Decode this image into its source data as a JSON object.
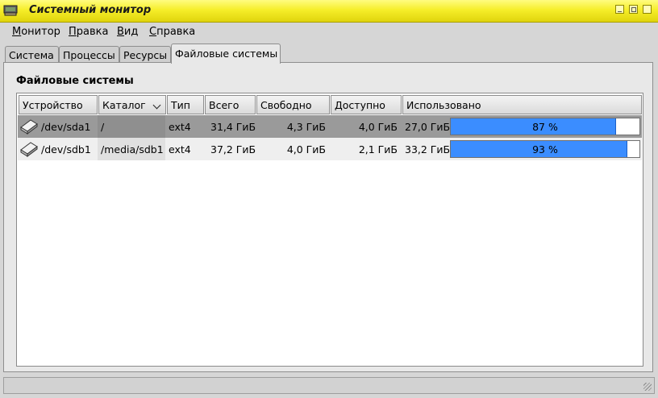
{
  "window": {
    "title": "Системный монитор"
  },
  "menu": [
    "Монитор",
    "Правка",
    "Вид",
    "Справка"
  ],
  "tabs": [
    "Система",
    "Процессы",
    "Ресурсы",
    "Файловые системы"
  ],
  "active_tab": 3,
  "section_title": "Файловые системы",
  "columns": [
    "Устройство",
    "Каталог",
    "Тип",
    "Всего",
    "Свободно",
    "Доступно",
    "Использовано"
  ],
  "rows": [
    {
      "device": "/dev/sda1",
      "dir": "/",
      "type": "ext4",
      "total": "31,4 ГиБ",
      "free": "4,3 ГиБ",
      "avail": "4,0 ГиБ",
      "used": "27,0 ГиБ",
      "percent_label": "87 %",
      "percent": 87,
      "selected": true
    },
    {
      "device": "/dev/sdb1",
      "dir": "/media/sdb1",
      "type": "ext4",
      "total": "37,2 ГиБ",
      "free": "4,0 ГиБ",
      "avail": "2,1 ГиБ",
      "used": "33,2 ГиБ",
      "percent_label": "93 %",
      "percent": 93,
      "selected": false
    }
  ],
  "colors": {
    "titlebar": "#f6ee2a",
    "bar_fill": "#3b8dff",
    "selected_row": "#9a9a9a"
  }
}
